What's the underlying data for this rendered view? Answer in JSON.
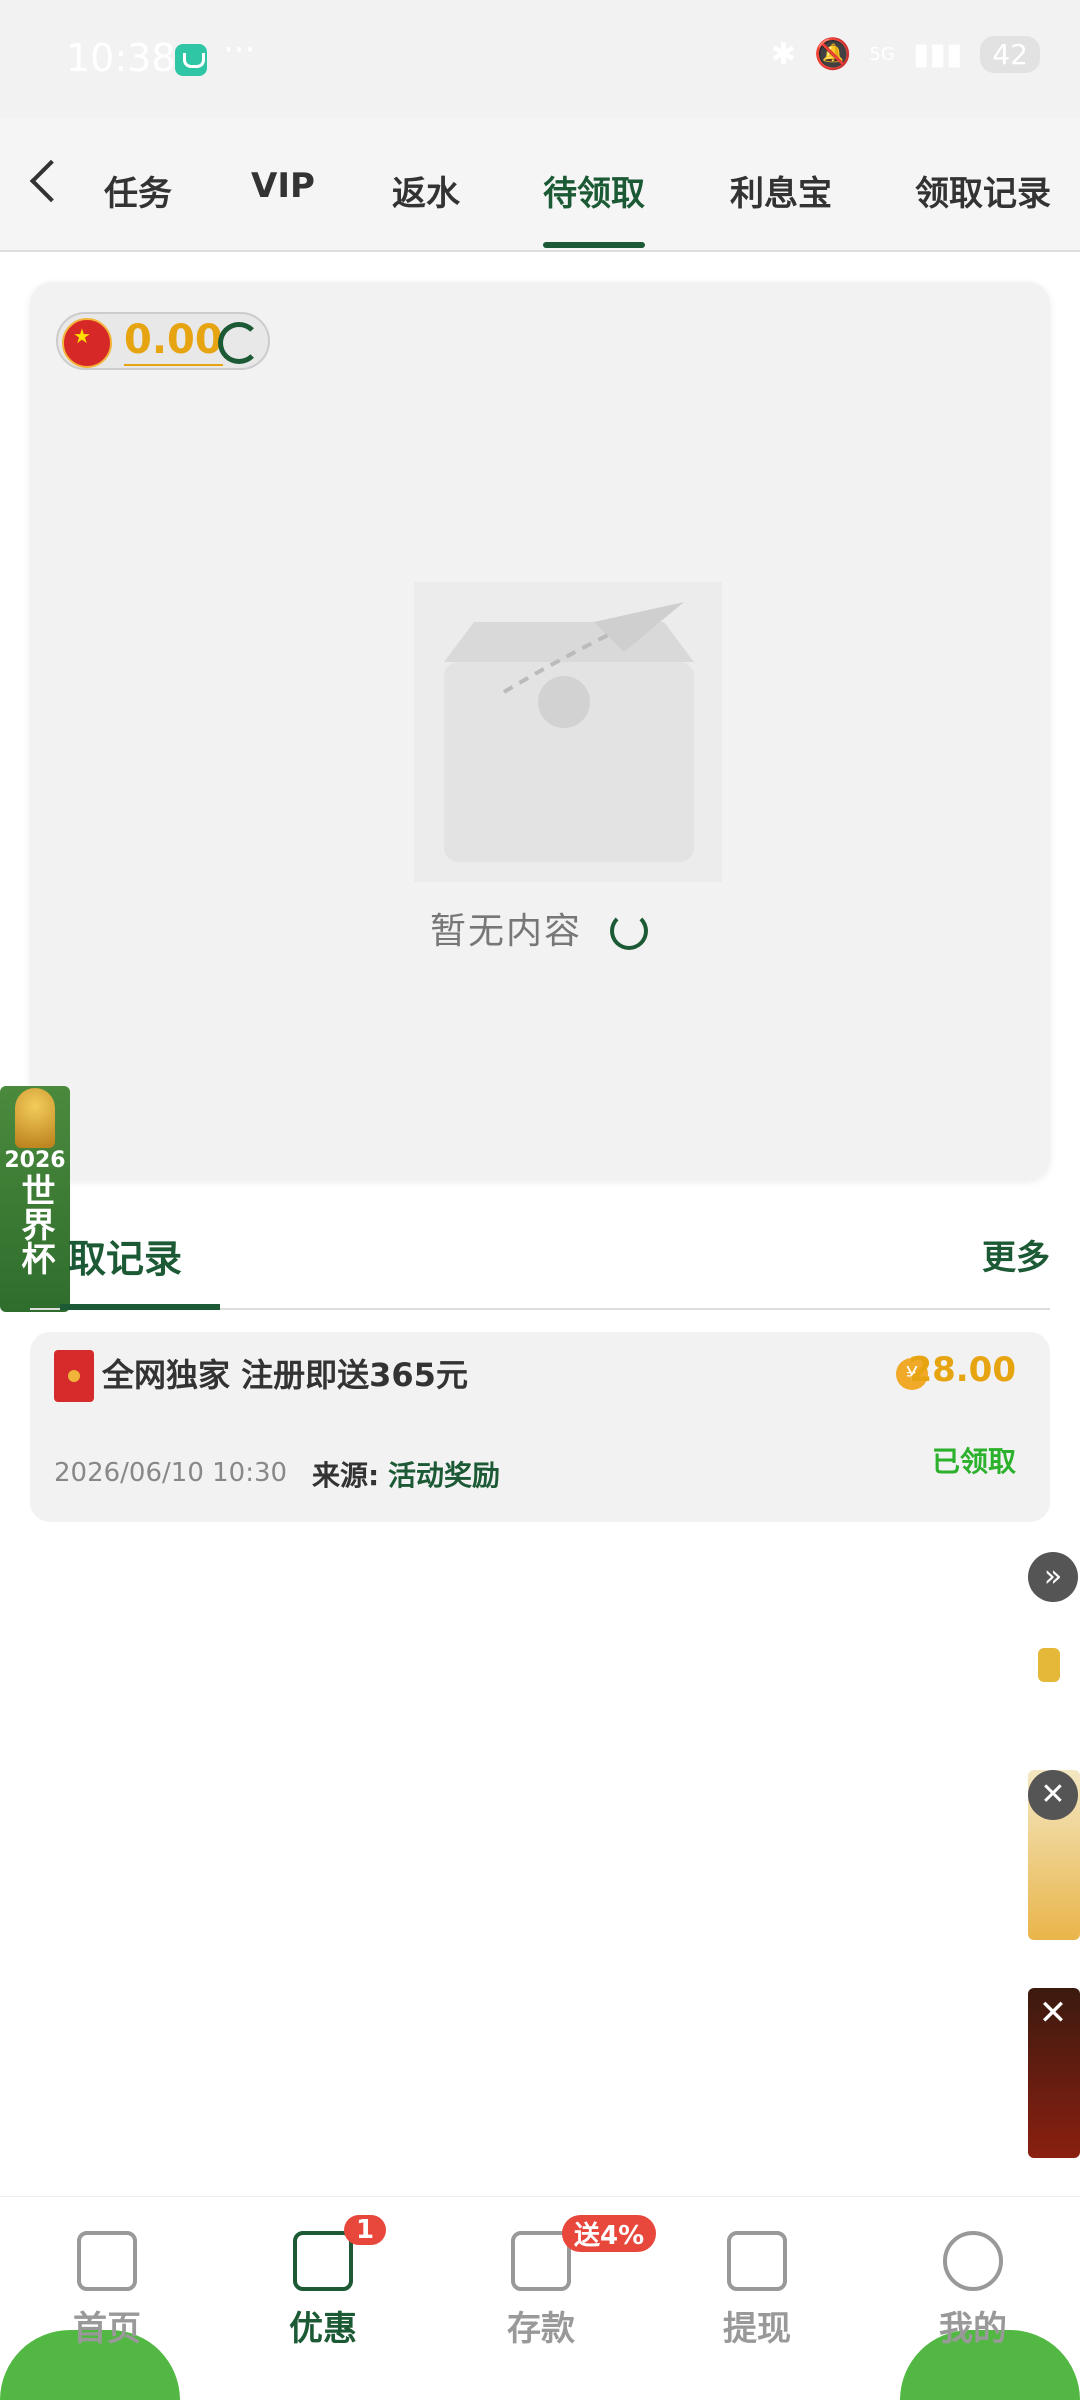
{
  "status_bar": {
    "time": "10:38",
    "dots": "···",
    "network": "5G",
    "battery": "42"
  },
  "tabs": {
    "items": [
      {
        "label": "任务"
      },
      {
        "label": "VIP"
      },
      {
        "label": "返水"
      },
      {
        "label": "待领取",
        "active": true
      },
      {
        "label": "利息宝"
      },
      {
        "label": "领取记录"
      }
    ]
  },
  "balance": {
    "value": "0.00"
  },
  "empty_state": {
    "text": "暂无内容"
  },
  "records": {
    "title": "取记录",
    "more": "更多",
    "items": [
      {
        "title": "全网独家 注册即送365元",
        "amount": "28.00",
        "coin_symbol": "¥",
        "date": "2026/06/10 10:30",
        "source_label": "来源:",
        "source_value": "活动奖励",
        "status": "已领取"
      }
    ]
  },
  "world_cup_banner": {
    "year": "2026",
    "text": "世界杯"
  },
  "bottom_nav": {
    "items": [
      {
        "label": "首页"
      },
      {
        "label": "优惠",
        "badge": "1",
        "active": true
      },
      {
        "label": "存款",
        "badge": "送4%"
      },
      {
        "label": "提现"
      },
      {
        "label": "我的"
      }
    ]
  },
  "colors": {
    "accent": "#1c5a35",
    "amount": "#e6a411",
    "success": "#2cb12c",
    "badge": "#e8473c"
  }
}
